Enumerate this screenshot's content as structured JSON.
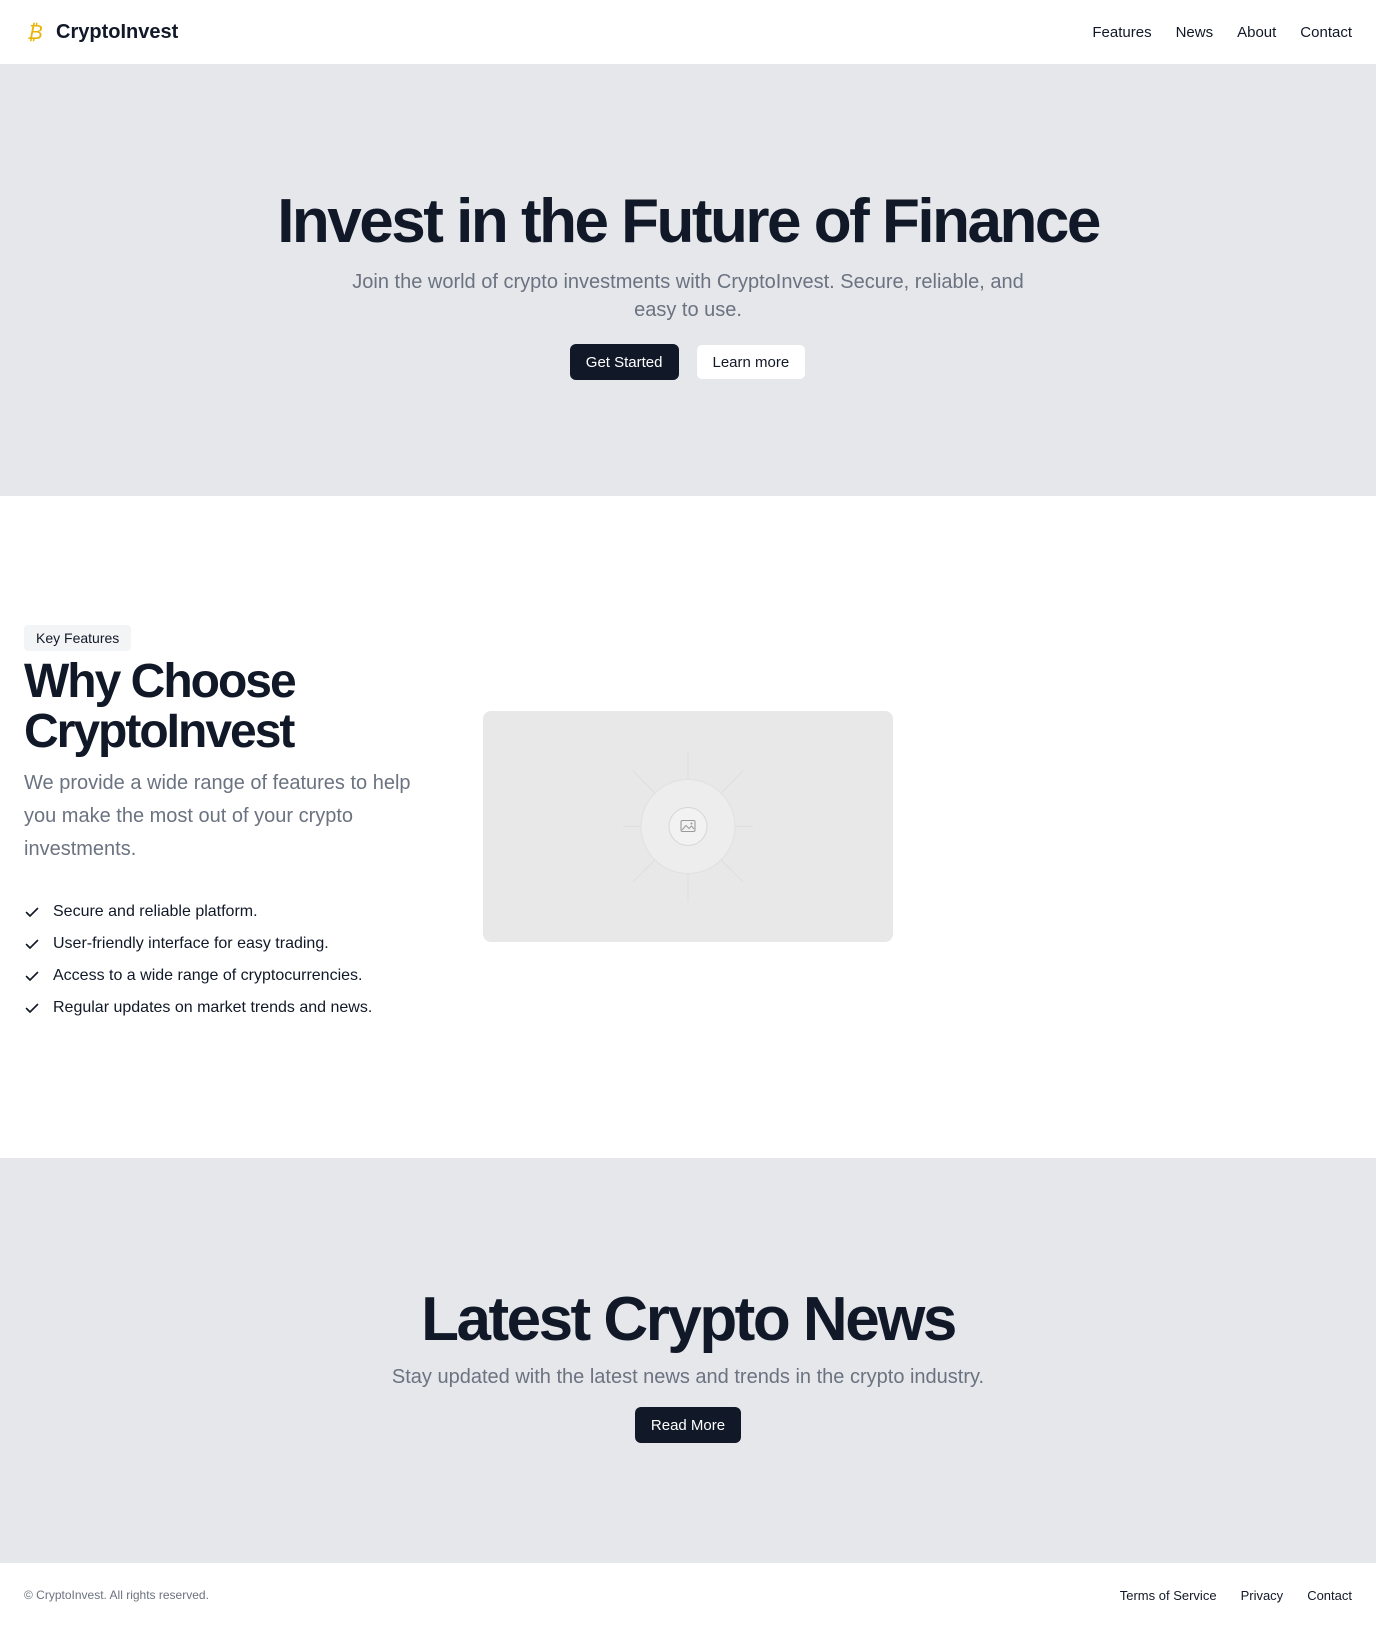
{
  "header": {
    "brand_name": "CryptoInvest",
    "brand_icon": "bitcoin-icon",
    "nav": [
      "Features",
      "News",
      "About",
      "Contact"
    ]
  },
  "hero": {
    "title": "Invest in the Future of Finance",
    "subtitle": "Join the world of crypto investments with CryptoInvest. Secure, reliable, and easy to use.",
    "primary_button": "Get Started",
    "secondary_button": "Learn more"
  },
  "features": {
    "badge": "Key Features",
    "title": "Why Choose CryptoInvest",
    "subtitle": "We provide a wide range of features to help you make the most out of your crypto investments.",
    "items": [
      "Secure and reliable platform.",
      "User-friendly interface for easy trading.",
      "Access to a wide range of cryptocurrencies.",
      "Regular updates on market trends and news."
    ],
    "image_icon": "image-placeholder-icon"
  },
  "news": {
    "title": "Latest Crypto News",
    "subtitle": "Stay updated with the latest news and trends in the crypto industry.",
    "button": "Read More"
  },
  "footer": {
    "copyright": "© CryptoInvest. All rights reserved.",
    "links": [
      "Terms of Service",
      "Privacy",
      "Contact"
    ]
  },
  "colors": {
    "brand_icon": "#eab308",
    "primary_dark": "#111827",
    "section_gray": "#e5e7eb",
    "muted_text": "#6b7280"
  }
}
